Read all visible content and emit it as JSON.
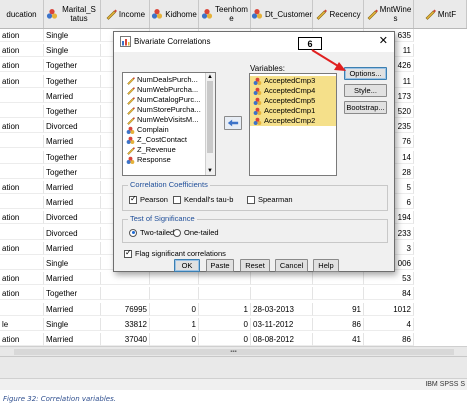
{
  "grid": {
    "headers": [
      {
        "label": "ducation",
        "icon": ""
      },
      {
        "label": "Marital_S tatus",
        "icon": "nominal-icon"
      },
      {
        "label": "Income",
        "icon": "scale-icon"
      },
      {
        "label": "Kidhome",
        "icon": "nominal-icon"
      },
      {
        "label": "Teenhom e",
        "icon": "nominal-icon"
      },
      {
        "label": "Dt_Customer",
        "icon": "nominal-icon"
      },
      {
        "label": "Recency",
        "icon": "scale-icon"
      },
      {
        "label": "MntWine s",
        "icon": "scale-icon"
      },
      {
        "label": "MntF",
        "icon": "scale-icon"
      }
    ],
    "rows": [
      [
        "ation",
        "Single",
        "",
        "",
        "",
        "",
        "",
        "635"
      ],
      [
        "ation",
        "Single",
        "",
        "",
        "",
        "",
        "",
        "11"
      ],
      [
        "ation",
        "Together",
        "",
        "",
        "",
        "",
        "",
        "426"
      ],
      [
        "ation",
        "Together",
        "",
        "",
        "",
        "",
        "",
        "11"
      ],
      [
        "",
        "Married",
        "",
        "",
        "",
        "",
        "",
        "173"
      ],
      [
        "",
        "Together",
        "",
        "",
        "",
        "",
        "",
        "520"
      ],
      [
        "ation",
        "Divorced",
        "",
        "",
        "",
        "",
        "",
        "235"
      ],
      [
        "",
        "Married",
        "",
        "",
        "",
        "",
        "",
        "76"
      ],
      [
        "",
        "Together",
        "",
        "",
        "",
        "",
        "",
        "14"
      ],
      [
        "",
        "Together",
        "",
        "",
        "",
        "",
        "",
        "28"
      ],
      [
        "ation",
        "Married",
        "",
        "",
        "",
        "",
        "",
        "5"
      ],
      [
        "",
        "Married",
        "",
        "",
        "",
        "",
        "",
        "6"
      ],
      [
        "ation",
        "Divorced",
        "",
        "",
        "",
        "",
        "",
        "194"
      ],
      [
        "",
        "Divorced",
        "",
        "",
        "",
        "",
        "",
        "233"
      ],
      [
        "ation",
        "Married",
        "",
        "",
        "",
        "",
        "",
        "3"
      ],
      [
        "",
        "Single",
        "",
        "",
        "",
        "",
        "",
        "006"
      ],
      [
        "ation",
        "Married",
        "",
        "",
        "",
        "",
        "",
        "53"
      ],
      [
        "ation",
        "Together",
        "",
        "",
        "",
        "",
        "",
        "84"
      ],
      [
        "",
        "Married",
        "76995",
        "0",
        "1",
        "28-03-2013",
        "91",
        "1012"
      ],
      [
        "le",
        "Single",
        "33812",
        "1",
        "0",
        "03-11-2012",
        "86",
        "4"
      ],
      [
        "ation",
        "Married",
        "37040",
        "0",
        "0",
        "08-08-2012",
        "41",
        "86"
      ]
    ]
  },
  "dialog": {
    "title": "Bivariate Correlations",
    "close_label": "✕",
    "variables_label": "Variables:",
    "source_items": [
      "NumDealsPurch...",
      "NumWebPurcha...",
      "NumCatalogPurc...",
      "NumStorePurcha...",
      "NumWebVisitsM...",
      "Complain",
      "Z_CostContact",
      "Z_Revenue",
      "Response"
    ],
    "source_icons": [
      "scale-icon",
      "scale-icon",
      "scale-icon",
      "scale-icon",
      "scale-icon",
      "nominal-icon",
      "nominal-icon",
      "scale-icon",
      "nominal-icon"
    ],
    "variables": [
      "AcceptedCmp3",
      "AcceptedCmp4",
      "AcceptedCmp5",
      "AcceptedCmp1",
      "AcceptedCmp2"
    ],
    "side_buttons": {
      "options": "Options...",
      "style": "Style...",
      "bootstrap": "Bootstrap..."
    },
    "coef_legend": "Correlation Coefficients",
    "pearson": "Pearson",
    "kendall": "Kendall's tau-b",
    "spearman": "Spearman",
    "sig_legend": "Test of Significance",
    "two_tailed": "Two-tailed",
    "one_tailed": "One-tailed",
    "flag": "Flag significant correlations",
    "buttons": {
      "ok": "OK",
      "paste": "Paste",
      "reset": "Reset",
      "cancel": "Cancel",
      "help": "Help"
    }
  },
  "callout": "6",
  "status": "IBM SPSS S",
  "caption": "Figure 32: Correlation variables.",
  "colors": {
    "selection": "#f5e08a",
    "arrow": "#e02020",
    "caption": "#2f4f8f"
  }
}
